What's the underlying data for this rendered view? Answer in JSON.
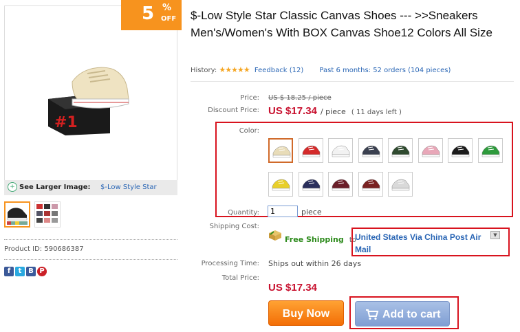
{
  "discount": {
    "number": "5",
    "percent_sign": "%",
    "off": "OFF"
  },
  "larger_image": {
    "label": "See Larger Image:",
    "link": "$-Low Style Star"
  },
  "product_id": "Product ID: 590686387",
  "share_icons": [
    "facebook-icon",
    "twitter-icon",
    "blogger-icon",
    "pinterest-icon"
  ],
  "title": "$-Low Style Star Classic Canvas Shoes --- >>Sneakers Men's/Women's With BOX Canvas Shoe12 Colors All Size",
  "history": {
    "label": "History:",
    "stars": "★★★★★",
    "feedback": "Feedback (12)",
    "orders": "Past 6 months: 52 orders (104 pieces)"
  },
  "price": {
    "label": "Price:",
    "old": "US $ 18.25 / piece",
    "discount_label": "Discount Price:",
    "new": "US $17.34",
    "unit": "/ piece",
    "time_left": "( 11 days left )"
  },
  "color": {
    "label": "Color:",
    "swatches": [
      {
        "shoe": "#e8dcb8",
        "sole": "#ffffff"
      },
      {
        "shoe": "#d42a2a",
        "sole": "#ffffff"
      },
      {
        "shoe": "#f2f2f2",
        "sole": "#ffffff"
      },
      {
        "shoe": "#3b4150",
        "sole": "#ffffff"
      },
      {
        "shoe": "#2f4a2f",
        "sole": "#ffffff"
      },
      {
        "shoe": "#e8a7b8",
        "sole": "#ffffff"
      },
      {
        "shoe": "#1c1c1c",
        "sole": "#ffffff"
      },
      {
        "shoe": "#2e9a3c",
        "sole": "#ffffff"
      },
      {
        "shoe": "#e8cf2a",
        "sole": "#ffffff"
      },
      {
        "shoe": "#2a2f5c",
        "sole": "#ffffff"
      },
      {
        "shoe": "#6b1f2a",
        "sole": "#ffffff"
      },
      {
        "shoe": "#7a2222",
        "sole": "#ffffff"
      },
      {
        "shoe": "#d9d9d9",
        "sole": "#f5f5f5"
      }
    ]
  },
  "quantity": {
    "label": "Quantity:",
    "value": "1",
    "unit": "piece"
  },
  "shipping": {
    "label": "Shipping Cost:",
    "free": "Free Shipping",
    "to": "to",
    "method": "United States Via China Post Air Mail"
  },
  "processing": {
    "label": "Processing Time:",
    "value": "Ships out within 26 days"
  },
  "total": {
    "label": "Total Price:",
    "value": "US $17.34"
  },
  "buttons": {
    "buy_now": "Buy Now",
    "add_to_cart": "Add to cart"
  },
  "colors": {
    "accent_orange": "#f7931e",
    "price_red": "#c8102e",
    "link_blue": "#2a66b5",
    "highlight_red": "#d8131e"
  }
}
